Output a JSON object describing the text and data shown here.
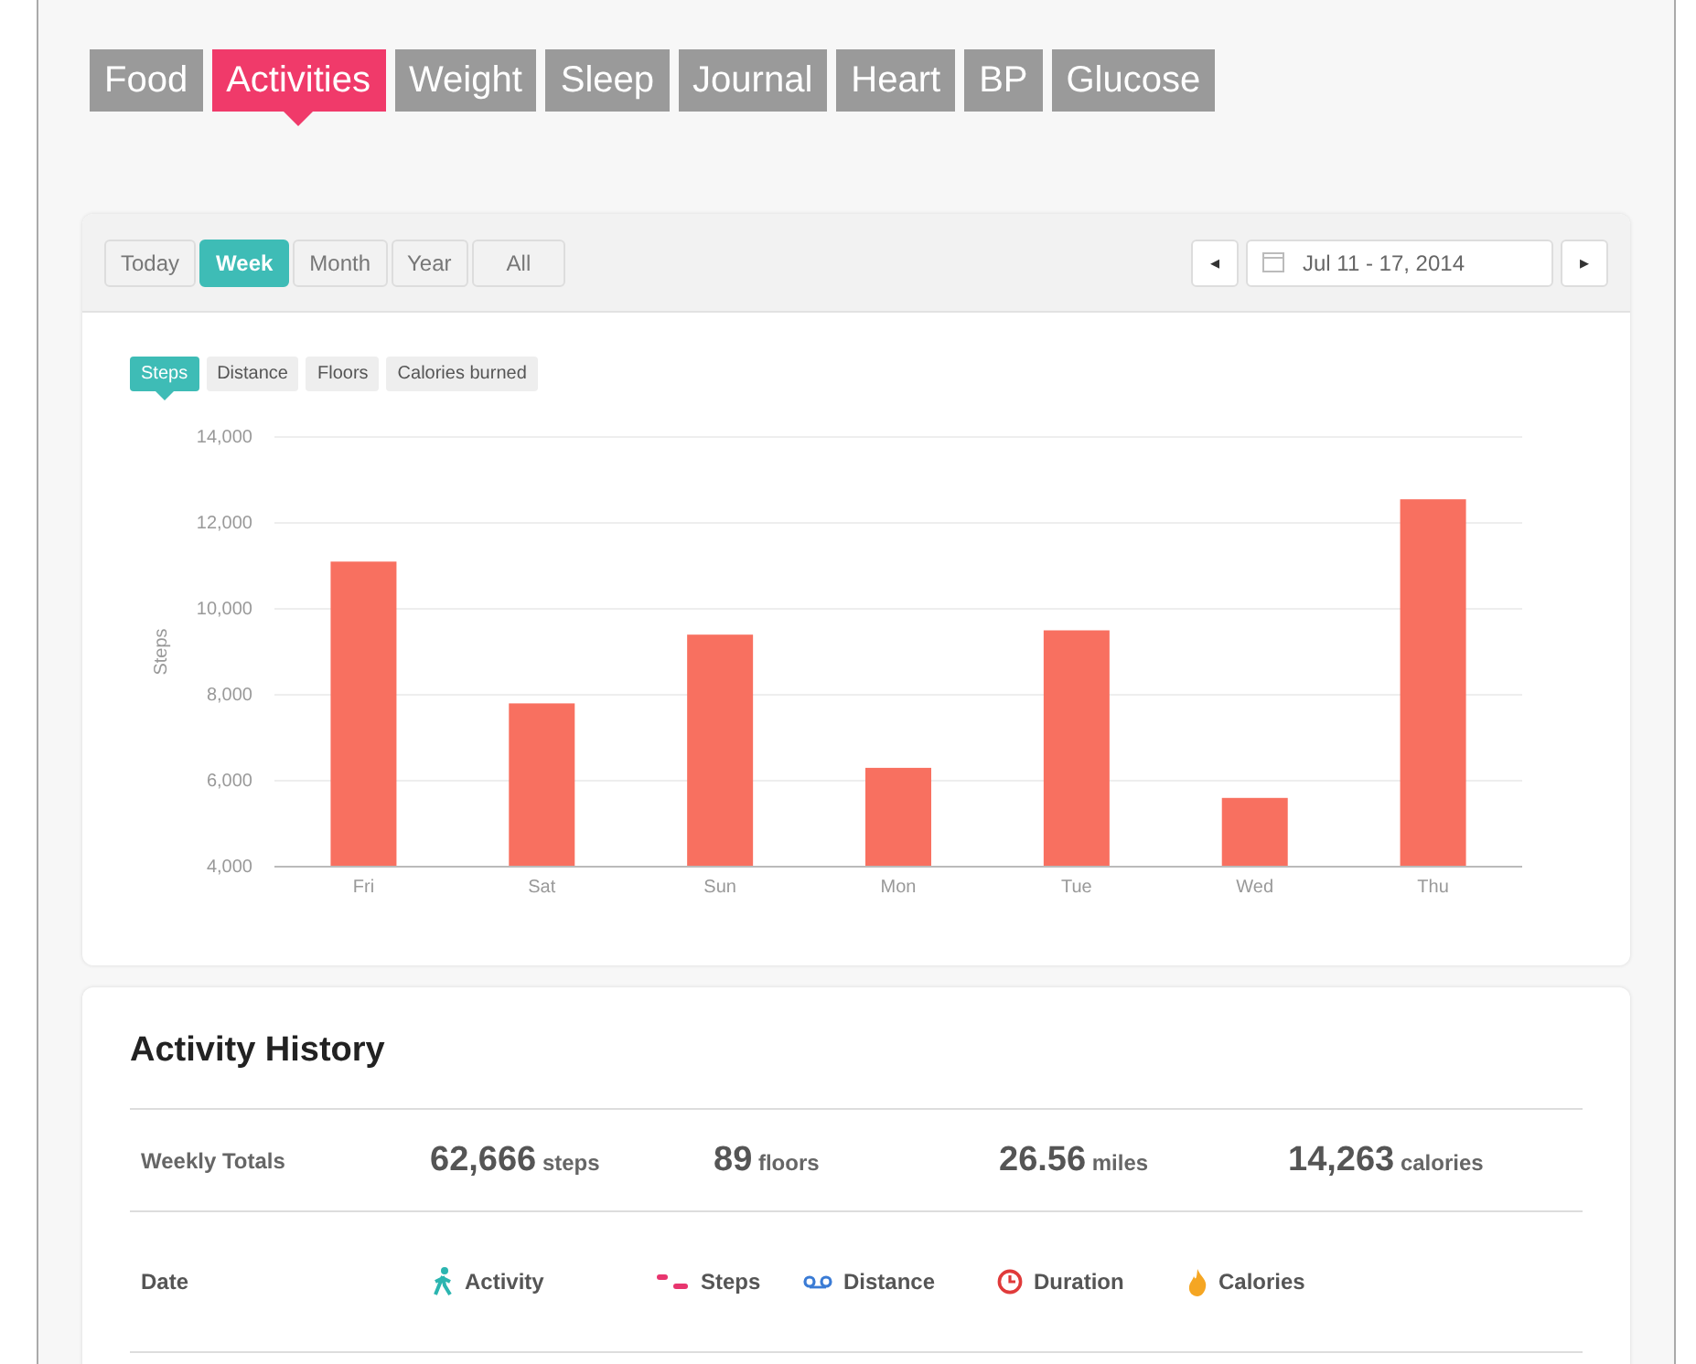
{
  "tabs": [
    {
      "label": "Food",
      "selected": false
    },
    {
      "label": "Activities",
      "selected": true
    },
    {
      "label": "Weight",
      "selected": false
    },
    {
      "label": "Sleep",
      "selected": false
    },
    {
      "label": "Journal",
      "selected": false
    },
    {
      "label": "Heart",
      "selected": false
    },
    {
      "label": "BP",
      "selected": false
    },
    {
      "label": "Glucose",
      "selected": false
    }
  ],
  "periods": [
    {
      "label": "Today",
      "selected": false
    },
    {
      "label": "Week",
      "selected": true
    },
    {
      "label": "Month",
      "selected": false
    },
    {
      "label": "Year",
      "selected": false
    },
    {
      "label": "All",
      "selected": false
    }
  ],
  "date_range": {
    "prev": "◂",
    "value": "Jul 11 - 17, 2014",
    "next": "▸"
  },
  "metrics": [
    {
      "label": "Steps",
      "selected": true
    },
    {
      "label": "Distance",
      "selected": false
    },
    {
      "label": "Floors",
      "selected": false
    },
    {
      "label": "Calories burned",
      "selected": false
    }
  ],
  "chart_data": {
    "type": "bar",
    "ylabel": "Steps",
    "categories": [
      "Fri",
      "Sat",
      "Sun",
      "Mon",
      "Tue",
      "Wed",
      "Thu"
    ],
    "values": [
      11100,
      7800,
      9400,
      6300,
      9500,
      5600,
      12550
    ],
    "grid": true,
    "ylim": [
      4000,
      14000
    ],
    "yticks": [
      {
        "value": 4000,
        "label": "4,000"
      },
      {
        "value": 6000,
        "label": "6,000"
      },
      {
        "value": 8000,
        "label": "8,000"
      },
      {
        "value": 10000,
        "label": "10,000"
      },
      {
        "value": 12000,
        "label": "12,000"
      },
      {
        "value": 14000,
        "label": "14,000"
      }
    ]
  },
  "history": {
    "title": "Activity History",
    "totals_label": "Weekly Totals",
    "totals": [
      {
        "value": "62,666",
        "unit": "steps"
      },
      {
        "value": "89",
        "unit": "floors"
      },
      {
        "value": "26.56",
        "unit": "miles"
      },
      {
        "value": "14,263",
        "unit": "calories"
      }
    ],
    "columns": [
      {
        "label": "Date",
        "kind": "plain"
      },
      {
        "label": "Activity",
        "kind": "activity"
      },
      {
        "label": "Steps",
        "kind": "steps"
      },
      {
        "label": "Distance",
        "kind": "distance"
      },
      {
        "label": "Duration",
        "kind": "duration"
      },
      {
        "label": "Calories",
        "kind": "calories"
      }
    ]
  }
}
